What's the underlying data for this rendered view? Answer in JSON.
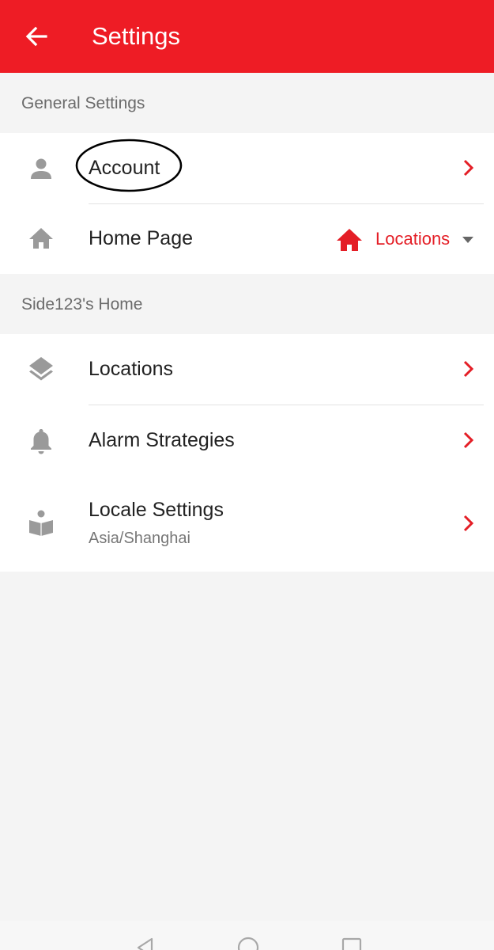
{
  "header": {
    "title": "Settings",
    "back_icon": "arrow-left-icon",
    "background": "#ee1c25"
  },
  "sections": [
    {
      "title": "General Settings",
      "items": [
        {
          "label": "Account",
          "icon": "person-icon"
        },
        {
          "label": "Home Page",
          "icon": "home-icon",
          "value": "Locations",
          "value_icon": "home-icon"
        }
      ]
    },
    {
      "title": "Side123's Home",
      "items": [
        {
          "label": "Locations",
          "icon": "layers-icon"
        },
        {
          "label": "Alarm Strategies",
          "icon": "bell-icon"
        },
        {
          "label": "Locale Settings",
          "icon": "book-person-icon",
          "subtitle": "Asia/Shanghai"
        }
      ]
    }
  ],
  "colors": {
    "accent": "#ee1c25",
    "chevron": "#e41e26",
    "icon_gray": "#9a9a9a",
    "background": "#f4f4f4"
  },
  "navbar": {
    "buttons": [
      "back-triangle-icon",
      "home-circle-icon",
      "recents-square-icon"
    ]
  }
}
